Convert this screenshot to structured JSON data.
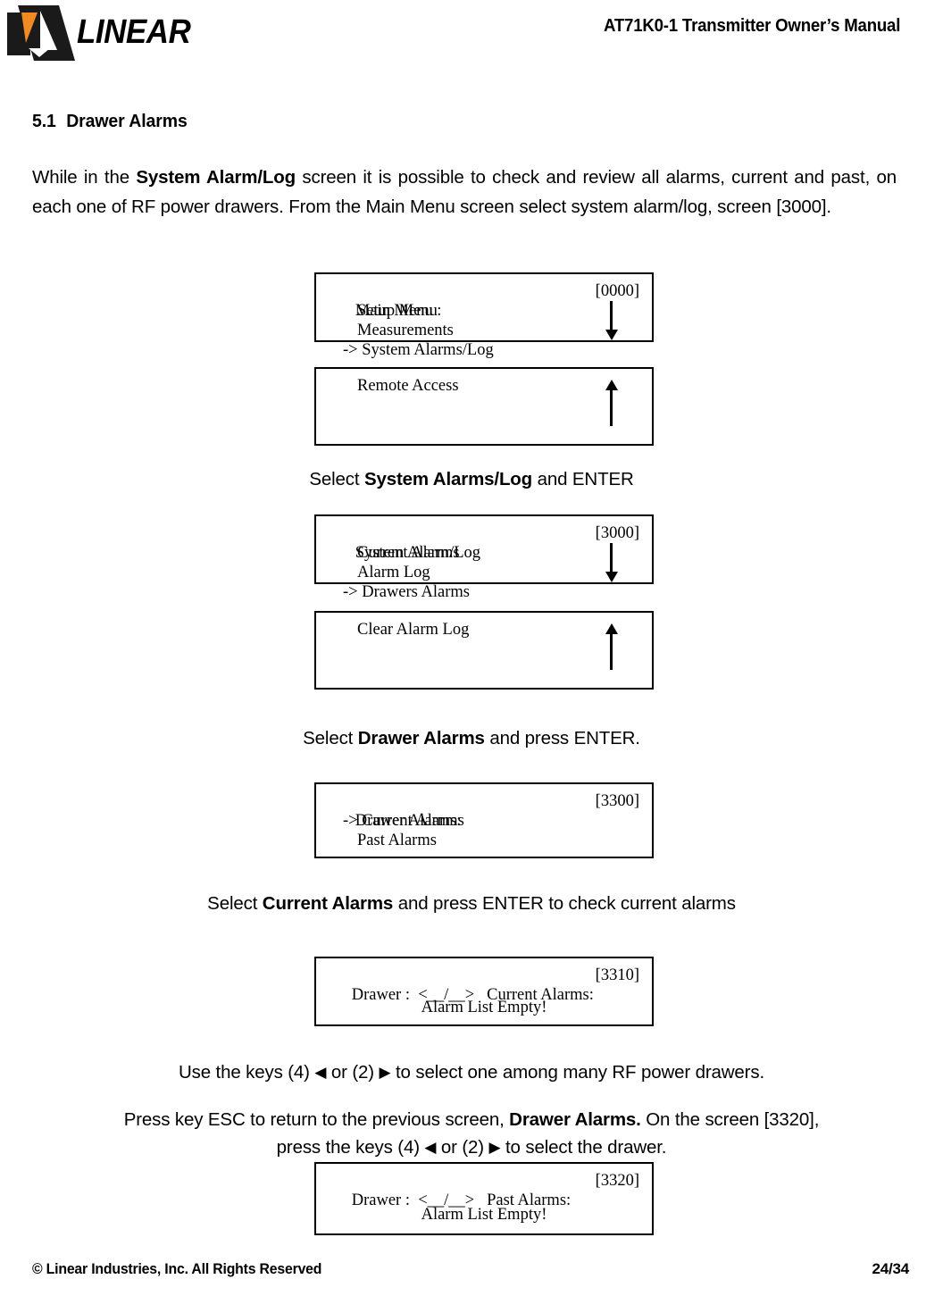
{
  "header": {
    "logo_text": "LINEAR",
    "logo_icon": "linear-logo-mark",
    "title": "AT71K0-1 Transmitter Owner’s Manual",
    "colors": {
      "logo_black": "#1a1a1a",
      "logo_orange": "#ef8b22"
    }
  },
  "section": {
    "number": "5.1",
    "title": "Drawer Alarms"
  },
  "intro": {
    "part1": "While in the ",
    "bold1": "System Alarm/Log",
    "part2": " screen it is possible to check and review all alarms, current and past, on each one of RF power drawers. From the Main Menu screen select system alarm/log, screen [3000]."
  },
  "captions": {
    "c1_pre": "Select ",
    "c1_bold": "System Alarms/Log",
    "c1_post": " and ENTER",
    "c2_pre": "Select ",
    "c2_bold": "Drawer Alarms",
    "c2_post": " and press ENTER.",
    "c3_pre": "Select ",
    "c3_bold": "Current Alarms",
    "c3_post": " and press ENTER to check current alarms",
    "c4_a": "Use the keys (4) ",
    "c4_left_arrow": "◀",
    "c4_b": " or (2) ",
    "c4_right_arrow": "▶",
    "c4_c": " to select one among many RF power drawers.",
    "c5_a": "Press key ESC to return to the previous screen, ",
    "c5_bold": "Drawer Alarms.",
    "c5_b": " On the screen [3320],",
    "c5_line2_a": "press the keys (4) ",
    "c5_left_arrow": "◀",
    "c5_line2_b": " or (2) ",
    "c5_right_arrow": "▶",
    "c5_line2_c": " to select the drawer."
  },
  "screens": [
    {
      "id": "main-menu",
      "title": "Main Menu :",
      "code": "[0000]",
      "lines": [
        "Setup Menu",
        "Measurements",
        "-> System Alarms/Log"
      ],
      "arrow": "down"
    },
    {
      "id": "remote-access",
      "title": "Remote Access",
      "code": "",
      "lines": [],
      "arrow": "up"
    },
    {
      "id": "system-alarm-log",
      "title": "System Alarm/Log",
      "code": "[3000]",
      "lines": [
        "Current Alarms",
        "Alarm Log",
        "-> Drawers Alarms"
      ],
      "arrow": "down"
    },
    {
      "id": "clear-alarm-log",
      "title": "Clear Alarm Log",
      "code": "",
      "lines": [],
      "arrow": "up"
    },
    {
      "id": "drawer-alarms",
      "title": "Drawer Alarms:",
      "code": "[3300]",
      "lines": [
        "-> Current Alarms",
        "Past Alarms"
      ],
      "arrow": "none"
    },
    {
      "id": "current-alarms",
      "title": "Drawer :  <__/__>   Current Alarms:",
      "code": "[3310]",
      "lines": [
        "Alarm List Empty!"
      ],
      "arrow": "none"
    },
    {
      "id": "past-alarms",
      "title": "Drawer :  <__/__>   Past Alarms:",
      "code": "[3320]",
      "lines": [
        "Alarm List Empty!"
      ],
      "arrow": "none"
    }
  ],
  "footer": {
    "copyright": "© Linear Industries, Inc. All Rights Reserved",
    "page": "24/34"
  }
}
